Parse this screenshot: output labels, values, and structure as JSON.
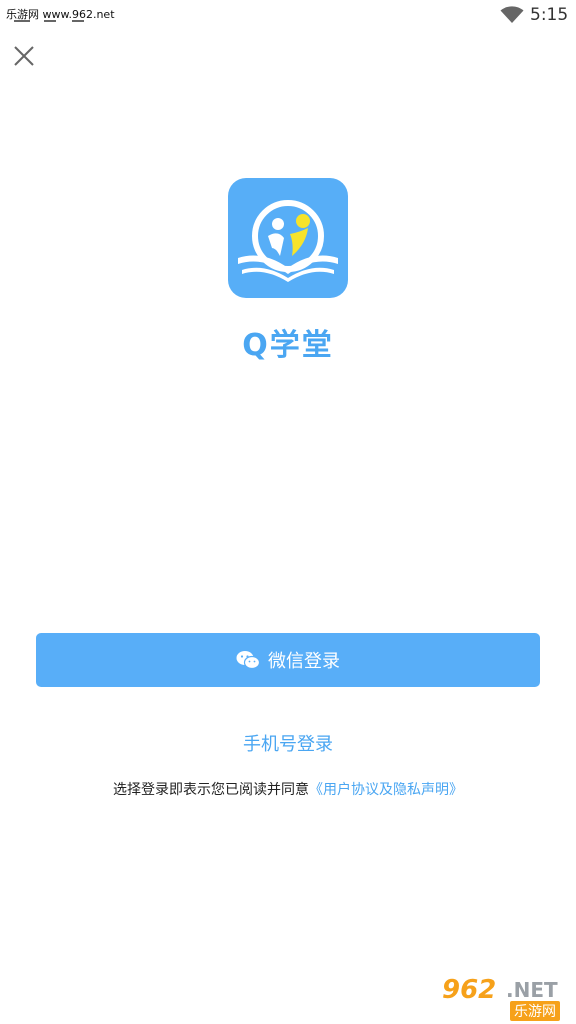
{
  "status_bar": {
    "watermark_text": "乐游网 www.962.net",
    "time": "5:15",
    "wifi_icon": "wifi-icon"
  },
  "close_icon": "close-icon",
  "app": {
    "name": "Q学堂",
    "logo_icon": "book-with-people-logo",
    "brand_color": "#57aef7"
  },
  "login": {
    "wechat_icon": "wechat-icon",
    "wechat_label": "微信登录",
    "phone_label": "手机号登录",
    "agreement_prefix": "选择登录即表示您已阅读并同意",
    "agreement_link": "《用户协议及隐私声明》"
  },
  "watermark": {
    "number": "962",
    "net": ".NET",
    "cn": "乐游网"
  }
}
